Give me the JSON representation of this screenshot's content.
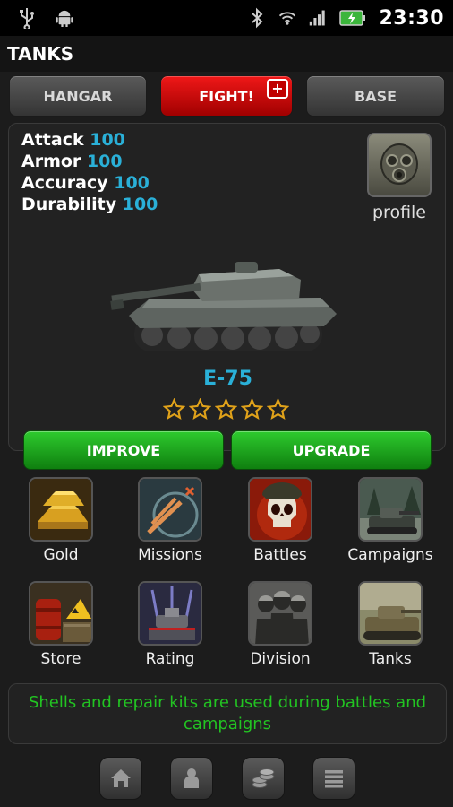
{
  "status_bar": {
    "time": "23:30",
    "icons": [
      "usb-icon",
      "android-icon",
      "bluetooth-icon",
      "wifi-icon",
      "signal-icon",
      "battery-icon"
    ]
  },
  "header": {
    "title": "TANKS"
  },
  "tabs": [
    {
      "label": "HANGAR"
    },
    {
      "label": "FIGHT!",
      "badge": "+"
    },
    {
      "label": "BASE"
    }
  ],
  "tank": {
    "stats": [
      {
        "name": "Attack",
        "value": "100"
      },
      {
        "name": "Armor",
        "value": "100"
      },
      {
        "name": "Accuracy",
        "value": "100"
      },
      {
        "name": "Durability",
        "value": "100"
      }
    ],
    "profile_label": "profile",
    "name": "E-75",
    "stars_filled": 0,
    "stars_total": 5
  },
  "actions": {
    "improve": "IMPROVE",
    "upgrade": "UPGRADE"
  },
  "menu": [
    {
      "label": "Gold",
      "icon": "gold-bars-icon"
    },
    {
      "label": "Missions",
      "icon": "missions-icon"
    },
    {
      "label": "Battles",
      "icon": "skull-icon"
    },
    {
      "label": "Campaigns",
      "icon": "campaigns-icon"
    },
    {
      "label": "Store",
      "icon": "store-icon"
    },
    {
      "label": "Rating",
      "icon": "rating-icon"
    },
    {
      "label": "Division",
      "icon": "division-icon"
    },
    {
      "label": "Tanks",
      "icon": "tank-icon"
    }
  ],
  "tip": "Shells and repair kits are used during battles and campaigns",
  "bottom_nav": [
    "home-icon",
    "person-icon",
    "coins-icon",
    "list-icon"
  ],
  "colors": {
    "stat_value": "#2ab0d8",
    "tip_text": "#22c422",
    "fight_red": "#e01010",
    "action_green": "#1fa51f"
  }
}
